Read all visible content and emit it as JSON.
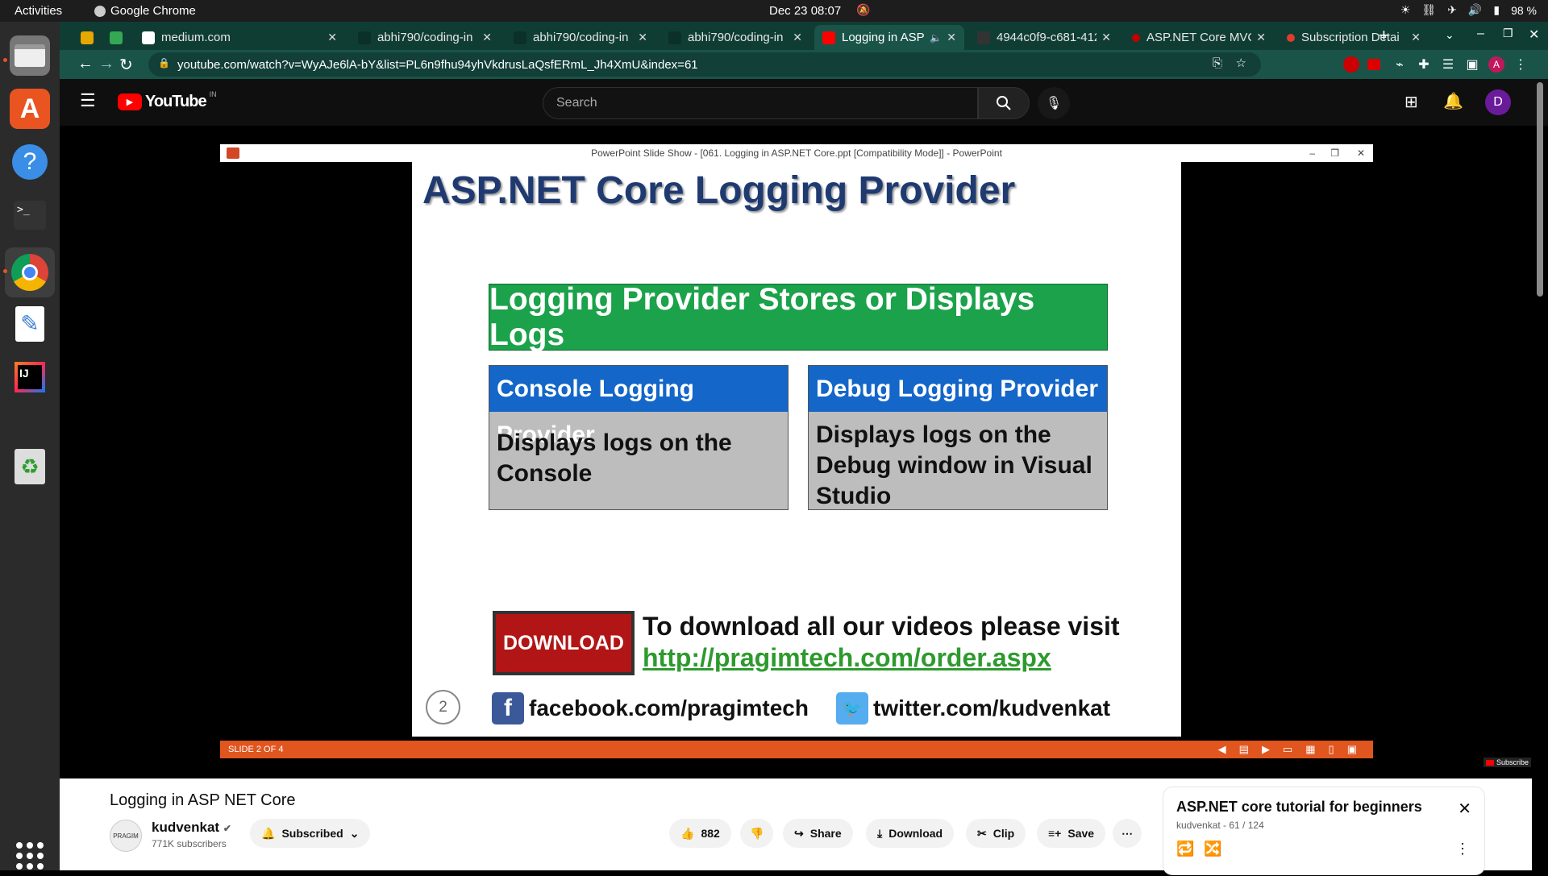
{
  "system": {
    "activities": "Activities",
    "app_name": "Google Chrome",
    "clock": "Dec 23  08:07",
    "battery": "98 %"
  },
  "tabs": [
    {
      "title": "",
      "fav_color": "#e6a700"
    },
    {
      "title": "",
      "fav_color": "#34a853"
    },
    {
      "title": "medium.com",
      "fav_color": "#ffffff"
    },
    {
      "title": "abhi790/coding-in",
      "fav_color": "#0b2f29"
    },
    {
      "title": "abhi790/coding-in",
      "fav_color": "#0b2f29"
    },
    {
      "title": "abhi790/coding-in",
      "fav_color": "#0b2f29"
    },
    {
      "title": "Logging in ASP",
      "fav_color": "#ff0000"
    },
    {
      "title": "4944c0f9-c681-412",
      "fav_color": "#333333"
    },
    {
      "title": "ASP.NET Core MVC",
      "fav_color": "#c00000"
    },
    {
      "title": "Subscription Detai",
      "fav_color": "#e03c2e"
    }
  ],
  "url": "youtube.com/watch?v=WyAJe6lA-bY&list=PL6n9fhu94yhVkdrusLaQsfERmL_Jh4XmU&index=61",
  "youtube": {
    "logo_text": "YouTube",
    "region": "IN",
    "search_placeholder": "Search",
    "avatar_letter": "D"
  },
  "slide": {
    "window_title": "PowerPoint Slide Show - [061. Logging in ASP.NET Core.ppt [Compatibility Mode]] - PowerPoint",
    "title": "ASP.NET Core Logging Provider",
    "green_box": "Logging Provider Stores or Displays Logs",
    "cards": [
      {
        "header": "Console Logging Provider",
        "body": "Displays logs on the Console"
      },
      {
        "header": "Debug Logging Provider",
        "body": "Displays logs on the Debug window in Visual Studio"
      }
    ],
    "download_button": "DOWNLOAD",
    "download_text": "To download all our videos please visit",
    "download_link": "http://pragimtech.com/order.aspx",
    "slide_number": "2",
    "facebook": "facebook.com/pragimtech",
    "twitter": "twitter.com/kudvenkat",
    "status": "SLIDE 2 OF 4",
    "subscribe_badge": "Subscribe"
  },
  "video": {
    "title": "Logging in ASP NET Core",
    "channel": "kudvenkat",
    "channel_avatar_text": "PRAGIM",
    "subscribers": "771K subscribers",
    "subscribed": "Subscribed",
    "likes": "882",
    "share": "Share",
    "download": "Download",
    "clip": "Clip",
    "save": "Save"
  },
  "playlist": {
    "title": "ASP.NET core tutorial for beginners",
    "subtitle": "kudvenkat - 61 / 124"
  }
}
